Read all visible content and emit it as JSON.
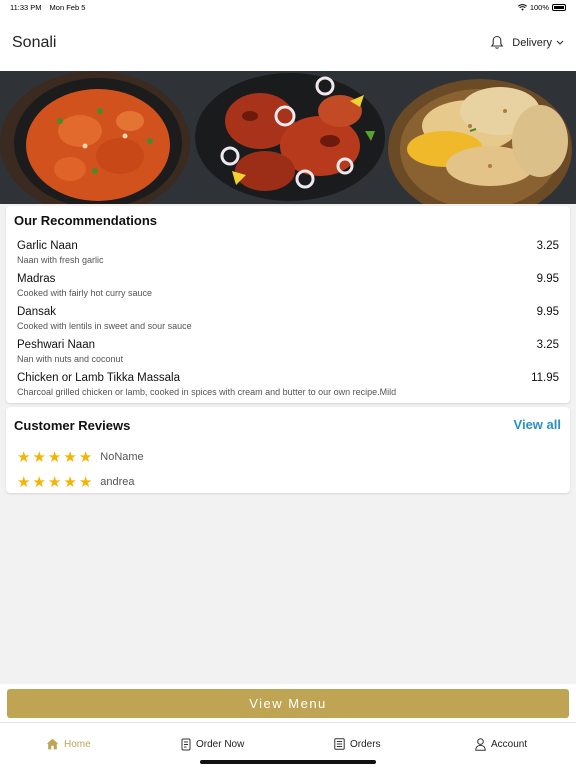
{
  "status_bar": {
    "time": "11:33 PM",
    "date": "Mon Feb 5",
    "battery": "100%"
  },
  "header": {
    "title": "Sonali",
    "delivery_label": "Delivery"
  },
  "recommendations": {
    "title": "Our Recommendations",
    "items": [
      {
        "name": "Garlic Naan",
        "description": "Naan with fresh garlic",
        "price": "3.25"
      },
      {
        "name": "Madras",
        "description": "Cooked with fairly hot curry sauce",
        "price": "9.95"
      },
      {
        "name": "Dansak",
        "description": "Cooked with lentils in sweet and sour sauce",
        "price": "9.95"
      },
      {
        "name": "Peshwari Naan",
        "description": "Nan with nuts and coconut",
        "price": "3.25"
      },
      {
        "name": "Chicken or Lamb Tikka Massala",
        "description": "Charcoal grilled chicken or lamb, cooked in spices with cream and butter to our own recipe.Mild",
        "price": "11.95"
      }
    ]
  },
  "reviews": {
    "title": "Customer Reviews",
    "view_all_label": "View all",
    "items": [
      {
        "name": "NoName",
        "rating": 5
      },
      {
        "name": "andrea",
        "rating": 5
      }
    ]
  },
  "view_menu_label": "View Menu",
  "tabs": [
    {
      "label": "Home",
      "icon": "home-icon",
      "active": true
    },
    {
      "label": "Order Now",
      "icon": "order-icon",
      "active": false
    },
    {
      "label": "Orders",
      "icon": "orders-list-icon",
      "active": false
    },
    {
      "label": "Account",
      "icon": "account-icon",
      "active": false
    }
  ],
  "colors": {
    "accent": "#bfa553",
    "link": "#2a8fc4",
    "star": "#f5b400"
  }
}
